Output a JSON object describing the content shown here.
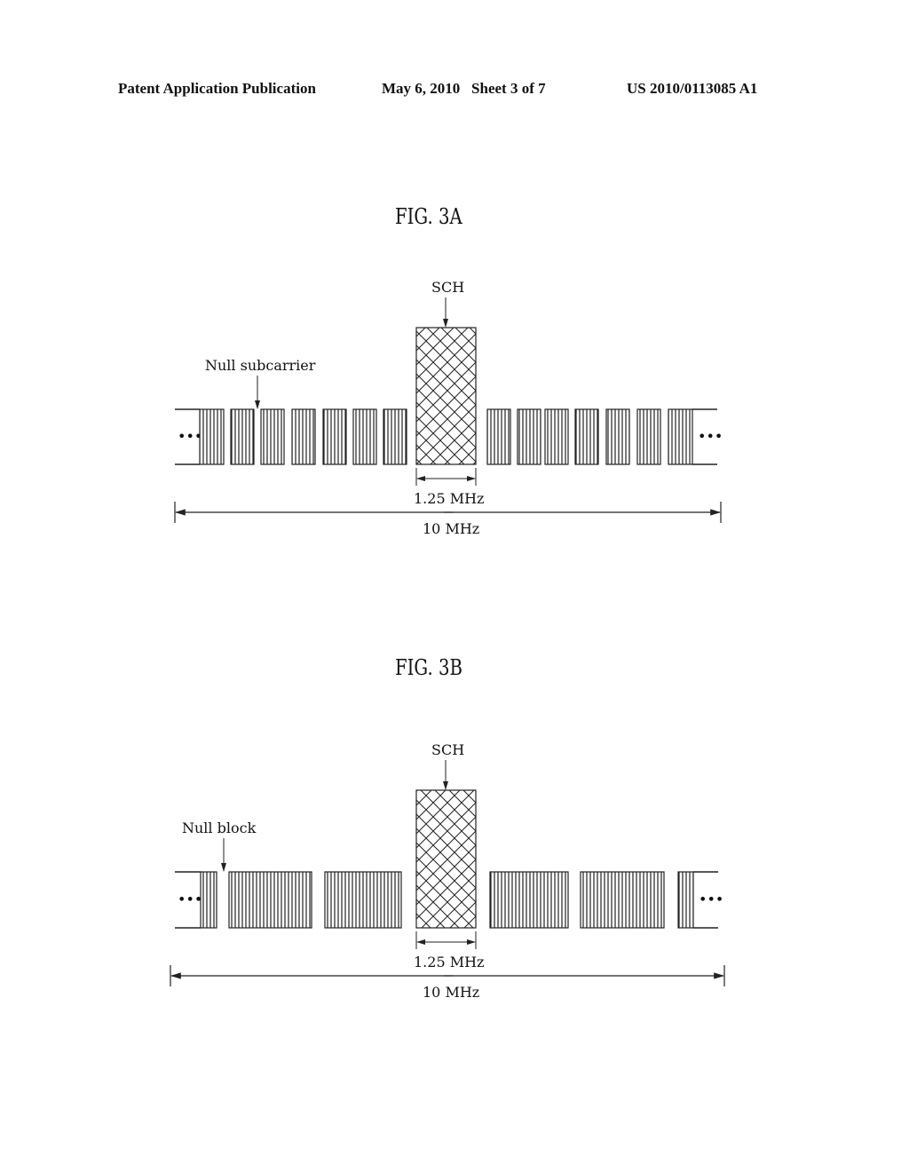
{
  "header": {
    "publication": "Patent Application Publication",
    "date_sheet": "May 6, 2010   Sheet 3 of 7",
    "number": "US 2010/0113085 A1"
  },
  "fig3a": {
    "title": "FIG. 3A",
    "sch_label": "SCH",
    "null_label": "Null subcarrier",
    "sch_bw": "1.25 MHz",
    "total_bw": "10 MHz",
    "ellipsis": "•••",
    "left_blocks": 7,
    "right_blocks": 7
  },
  "fig3b": {
    "title": "FIG. 3B",
    "sch_label": "SCH",
    "null_label": "Null block",
    "sch_bw": "1.25 MHz",
    "total_bw": "10 MHz",
    "ellipsis": "•••",
    "left_blocks": 3,
    "right_blocks": 3
  }
}
